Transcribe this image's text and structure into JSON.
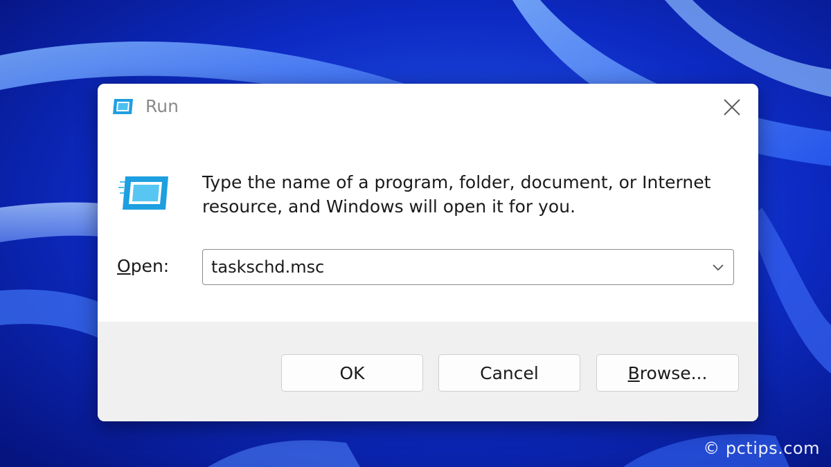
{
  "window": {
    "title": "Run",
    "close_icon": "close-icon",
    "title_icon": "run-icon"
  },
  "content": {
    "icon": "run-icon",
    "description": "Type the name of a program, folder, document, or Internet resource, and Windows will open it for you.",
    "open_label_mnemonic": "O",
    "open_label_rest": "pen:",
    "open_value": "taskschd.msc",
    "dropdown_icon": "chevron-down-icon"
  },
  "buttons": {
    "ok": "OK",
    "cancel": "Cancel",
    "browse_mnemonic": "B",
    "browse_rest": "rowse..."
  },
  "watermark": {
    "text": "© pctips.com"
  },
  "colors": {
    "wallpaper_base": "#0a1fa8",
    "accent_icon": "#1e9fe0",
    "footer_bg": "#f0f0f0"
  }
}
